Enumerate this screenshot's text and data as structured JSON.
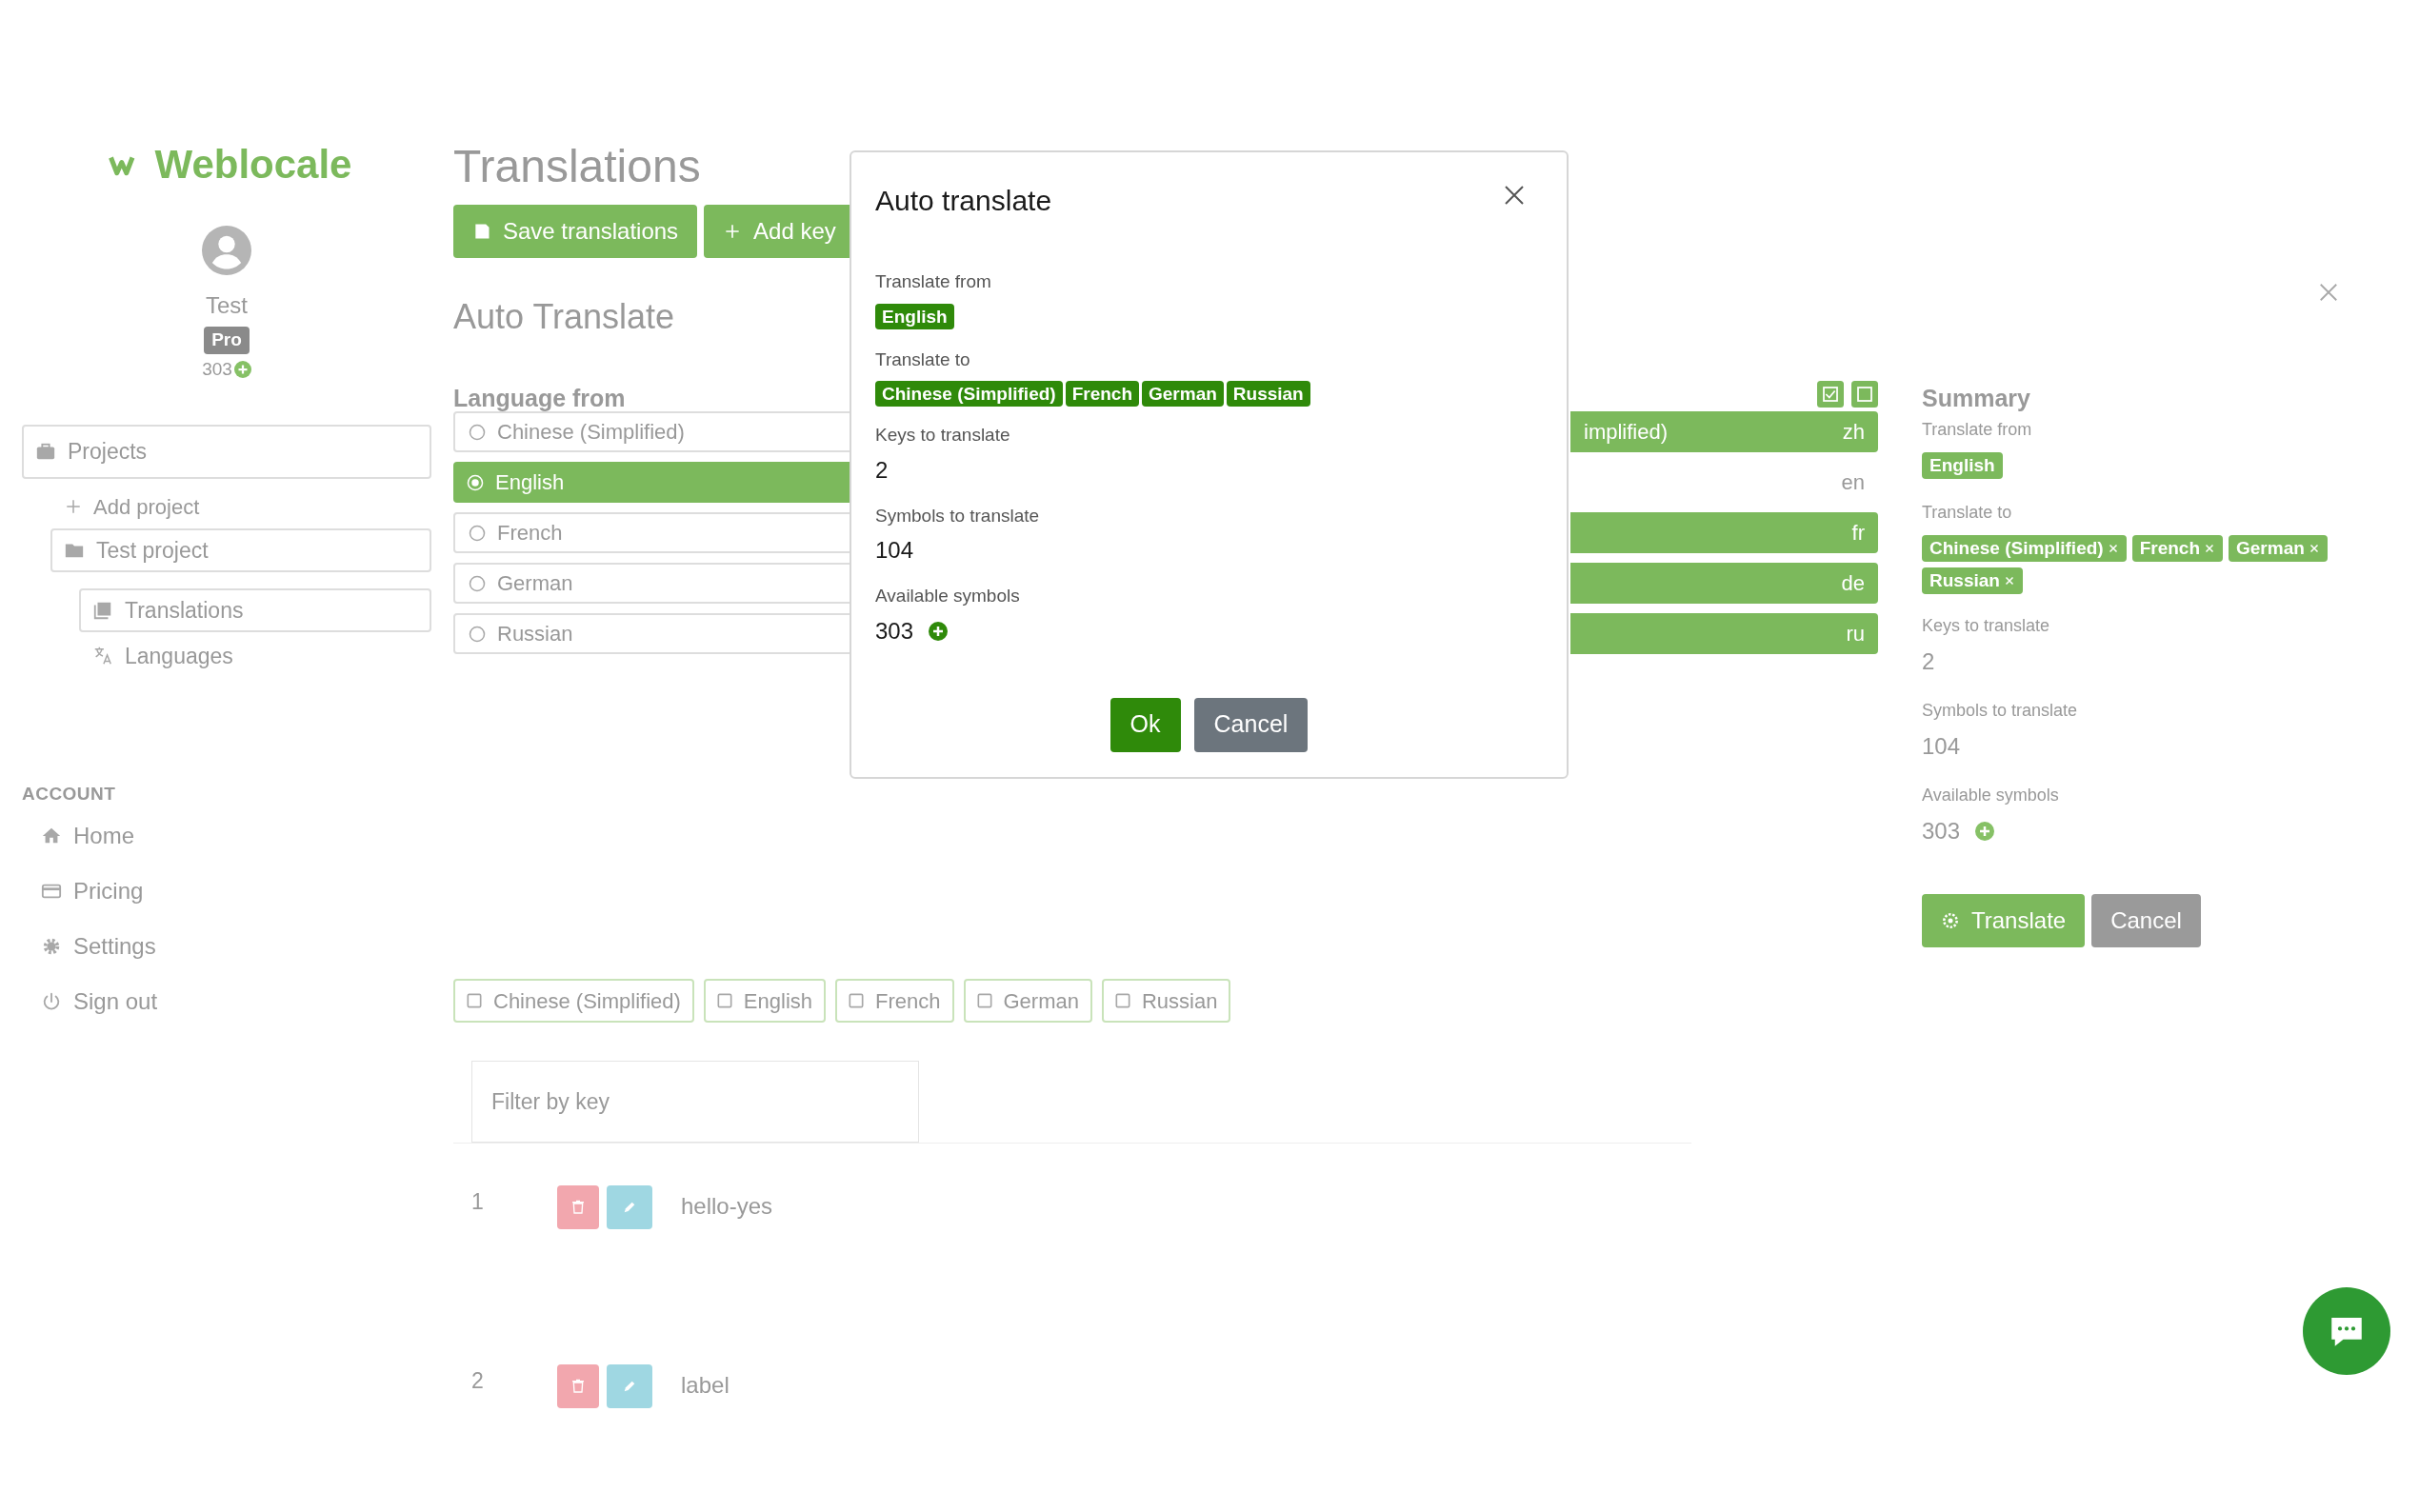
{
  "sidebar": {
    "logo": "Weblocale",
    "user": {
      "name": "Test",
      "plan": "Pro",
      "credits": "303"
    },
    "projects": {
      "label": "Projects",
      "selected": true
    },
    "add_project": "Add project",
    "project": {
      "label": "Test project",
      "selected": true,
      "children": [
        {
          "label": "Translations",
          "selected": true
        },
        {
          "label": "Languages",
          "selected": false
        }
      ]
    },
    "account": {
      "heading": "ACCOUNT",
      "items": [
        {
          "label": "Home",
          "kind": "home"
        },
        {
          "label": "Pricing",
          "kind": "card"
        },
        {
          "label": "Settings",
          "kind": "gear"
        },
        {
          "label": "Sign out",
          "kind": "power"
        }
      ]
    }
  },
  "main": {
    "title": "Translations",
    "toolbar": [
      {
        "label": "Save translations",
        "kind": "save"
      },
      {
        "label": "Add key",
        "kind": "add"
      }
    ],
    "section_title": "Auto Translate",
    "language_from": {
      "heading": "Language from",
      "options": [
        {
          "label": "Chinese (Simplified)",
          "selected": false
        },
        {
          "label": "English",
          "selected": true
        },
        {
          "label": "French",
          "selected": false
        },
        {
          "label": "German",
          "selected": false
        },
        {
          "label": "Russian",
          "selected": false
        }
      ]
    },
    "language_to": {
      "options": [
        {
          "label": "implified)",
          "code": "zh",
          "selected": true
        },
        {
          "code": "en",
          "selected": false
        },
        {
          "code": "fr",
          "selected": true
        },
        {
          "code": "de",
          "selected": true
        },
        {
          "code": "ru",
          "selected": true
        }
      ]
    },
    "summary": {
      "heading": "Summary",
      "from_label": "Translate from",
      "from": "English",
      "to_label": "Translate to",
      "to": [
        "Chinese (Simplified)",
        "French",
        "German",
        "Russian"
      ],
      "keys_label": "Keys to translate",
      "keys": "2",
      "symbols_label": "Symbols to translate",
      "symbols": "104",
      "available_label": "Available symbols",
      "available": "303",
      "buttons": [
        {
          "label": "Translate",
          "kind": "primary"
        },
        {
          "label": "Cancel",
          "kind": "secondary"
        }
      ]
    },
    "filters": [
      {
        "label": "Chinese (Simplified)",
        "checked": false
      },
      {
        "label": "English",
        "checked": false
      },
      {
        "label": "French",
        "checked": false
      },
      {
        "label": "German",
        "checked": false
      },
      {
        "label": "Russian",
        "checked": false
      }
    ],
    "filter_field": {
      "placeholder": "Filter by key"
    },
    "keys": [
      {
        "index": "1",
        "key": "hello-yes"
      },
      {
        "index": "2",
        "key": "label"
      }
    ]
  },
  "modal": {
    "title": "Auto translate",
    "from_label": "Translate from",
    "from": "English",
    "to_label": "Translate to",
    "to": [
      "Chinese (Simplified)",
      "French",
      "German",
      "Russian"
    ],
    "keys_label": "Keys to translate",
    "keys": "2",
    "symbols_label": "Symbols to translate",
    "symbols": "104",
    "available_label": "Available symbols",
    "available": "303",
    "buttons": [
      {
        "label": "Ok",
        "kind": "primary"
      },
      {
        "label": "Cancel",
        "kind": "secondary"
      }
    ]
  }
}
